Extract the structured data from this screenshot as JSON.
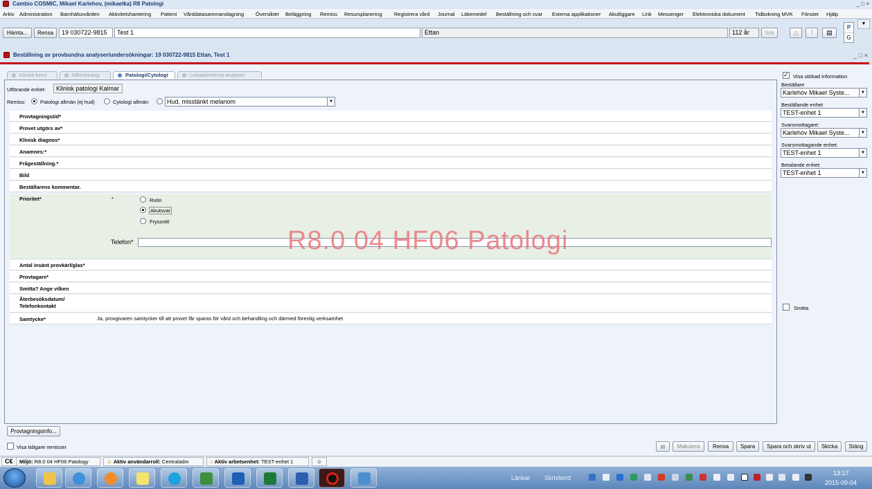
{
  "window": {
    "title": "Cambio COSMIC, Mikael  Karlehov, (mikaelka) R8 Patologi",
    "controls": [
      "_",
      "□",
      "×"
    ]
  },
  "menu": [
    "Arkiv",
    "Administration",
    "Barnhälsovården",
    "Aktivitetshantering",
    "Patient",
    "Vårddatasammanslagning",
    "Översikter",
    "Beläggning",
    "Remiss",
    "Resursplanering",
    "Registrera vård",
    "Journal",
    "Läkemedel",
    "Beställning och svar",
    "Externa applikationer",
    "Akutliggare",
    "Link",
    "Messenger",
    "Elektroniska dokument",
    "Tidbokning MVK",
    "Fönster",
    "Hjälp"
  ],
  "patient_bar": {
    "fetch_label": "Hämta...",
    "clear_label": "Rensa",
    "personnummer": "19 030722-9815",
    "first_name": "Test 1",
    "last_name": "Ettan",
    "age": "112 år",
    "search_label": "Sök",
    "p_label": "P",
    "g_label": "G"
  },
  "panel": {
    "title": "Beställning av provbundna analyser/undersökningar: 19 030722-9815 Ettan, Test 1"
  },
  "tabs": [
    {
      "label": "Klinisk kemi",
      "active": false
    },
    {
      "label": "Mikrobiologi",
      "active": false
    },
    {
      "label": "Patologi/Cytologi",
      "active": true
    },
    {
      "label": "Lokala/externa analyser",
      "active": false
    }
  ],
  "form": {
    "performing_unit_label": "Utförande enhet:",
    "performing_unit_value": "Klinisk patologi Kalmar",
    "referral_label": "Remiss:",
    "referral_options": [
      "Patologi allmän (ej hud)",
      "Cytologi allmän"
    ],
    "referral_selected": "Hud, misstänkt melanom",
    "rows_top": [
      "Provtagningstid*",
      "Provet utgörs av*",
      "Klinisk diagnos*",
      "Anamnes:*",
      "Frågeställning.*",
      "Bild",
      "Beställarens kommentar."
    ],
    "priority_label": "Prioritet*",
    "priority_star": "*",
    "priority_options": [
      "Rutin",
      "Akutsvar",
      "Fryssnitt"
    ],
    "priority_selected": "Akutsvar",
    "phone_label": "Telefon*",
    "phone_value": "",
    "rows_bottom": [
      "Antal insänt provkärl/glas*",
      "Provtagare*",
      "Smitta? Ange vilken"
    ],
    "revisit_label_1": "Återbesöksdatum/",
    "revisit_label_2": "Telefonkontakt",
    "consent_label": "Samtycke*",
    "consent_value": "Ja, provgivaren samtycker till att provet får sparas för vård och behandling och därmed förenlig verksamhet",
    "watermark": "R8.0 04 HF06 Patologi",
    "sampling_info_button": "Provtagningsinfo..."
  },
  "right_panel": {
    "show_extended_label": "Visa utökad information",
    "show_extended_checked": true,
    "orderer_label": "Beställare",
    "orderer_value": "Karlehov Mikael Syste...",
    "ordering_unit_label": "Beställande enhet",
    "ordering_unit_value": "TEST-enhet 1",
    "recipient_label": "Svarsmottagare:",
    "recipient_value": "Karlehov Mikael Syste...",
    "recipient_unit_label": "Svarsmottagande enhet:",
    "recipient_unit_value": "TEST-enhet 1",
    "paying_unit_label": "Betalande enhet:",
    "paying_unit_value": "TEST-enhet 1",
    "infection_label": "Smitta",
    "infection_checked": false
  },
  "bottom": {
    "show_previous_label": "Visa tidigare remisser",
    "buttons": [
      "Makulera",
      "Rensa",
      "Spara",
      "Spara och skriv ut",
      "Skicka",
      "Stäng"
    ]
  },
  "status_bar": {
    "ce": "C€",
    "env_label": "Miljö:",
    "env_value": "R8.0 04 HF06 Patology",
    "role_label": "Aktiv användarroll:",
    "role_value": "Centraladm",
    "unit_label": "Aktiv arbetsenhet:",
    "unit_value": "TEST-enhet 1"
  },
  "taskbar": {
    "links_label": "Länkar",
    "desktop_label": "Skrivbord",
    "time": "13:17",
    "date": "2015-09-04",
    "apps": [
      "explorer-icon",
      "ie-icon",
      "media-icon",
      "sticky-notes-icon",
      "skype-icon",
      "arrow-app-icon",
      "outlook-icon",
      "excel-icon",
      "word-icon",
      "cosmic-icon",
      "remote-desktop-icon"
    ]
  }
}
